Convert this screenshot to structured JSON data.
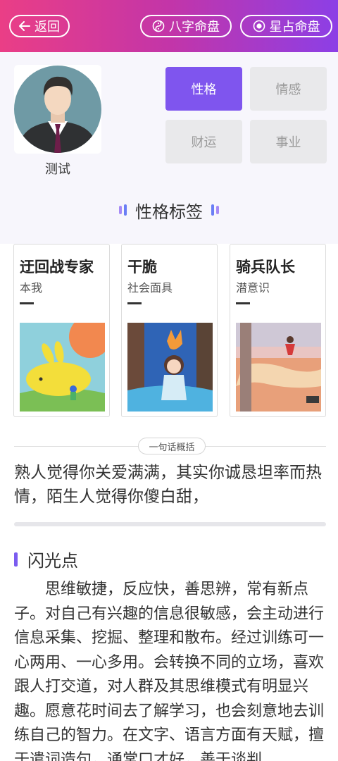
{
  "header": {
    "back_label": "返回",
    "bazi_label": "八字命盘",
    "star_label": "星占命盘"
  },
  "profile": {
    "name": "测试"
  },
  "tabs": [
    {
      "label": "性格",
      "active": true
    },
    {
      "label": "情感",
      "active": false
    },
    {
      "label": "财运",
      "active": false
    },
    {
      "label": "事业",
      "active": false
    }
  ],
  "tags_section": {
    "title": "性格标签"
  },
  "cards": [
    {
      "title": "迂回战专家",
      "subtitle": "本我",
      "dash": "—"
    },
    {
      "title": "干脆",
      "subtitle": "社会面具",
      "dash": "—"
    },
    {
      "title": "骑兵队长",
      "subtitle": "潜意识",
      "dash": "—"
    }
  ],
  "summary": {
    "badge": "一句话概括",
    "text": "熟人觉得你关爱满满，其实你诚恳坦率而热情，陌生人觉得你傻白甜，"
  },
  "highlight": {
    "title": "闪光点",
    "body": "思维敏捷，反应快，善思辨，常有新点子。对自己有兴趣的信息很敏感，会主动进行信息采集、挖掘、整理和散布。经过训练可一心两用、一心多用。会转换不同的立场，喜欢跟人打交道，对人群及其思维模式有明显兴趣。愿意花时间去了解学习，也会刻意地去训练自己的智力。在文字、语言方面有天赋，擅于遣词造句，通常口才好，善于谈判"
  },
  "colors": {
    "accent": "#7f55ee",
    "header_start": "#ea3e86",
    "header_end": "#8c3fe6"
  }
}
